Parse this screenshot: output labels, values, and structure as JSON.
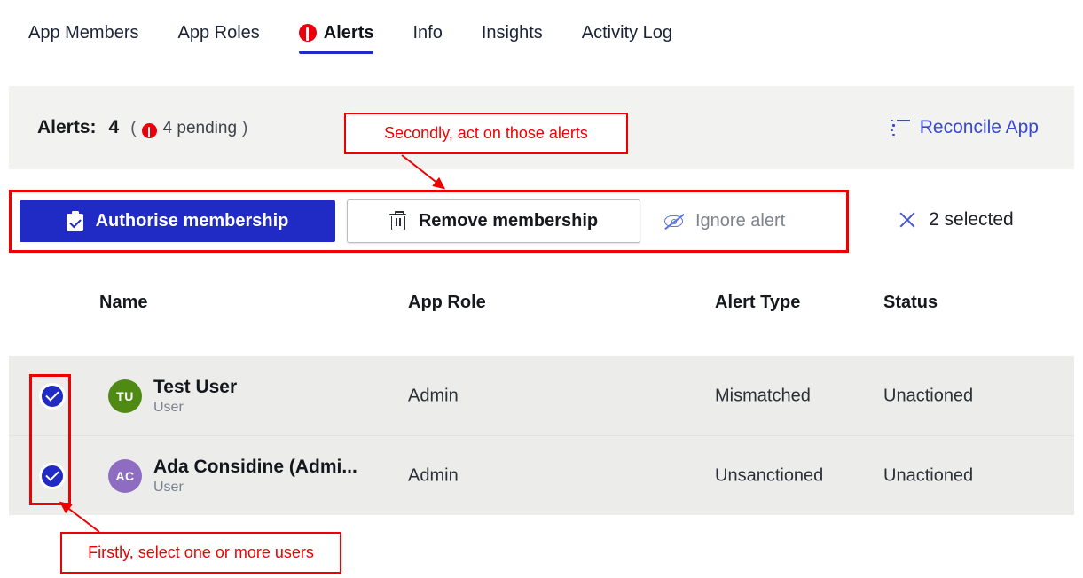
{
  "tabs": [
    {
      "label": "App Members",
      "active": false,
      "icon": null
    },
    {
      "label": "App Roles",
      "active": false,
      "icon": null
    },
    {
      "label": "Alerts",
      "active": true,
      "icon": "alert-exclamation-icon"
    },
    {
      "label": "Info",
      "active": false,
      "icon": null
    },
    {
      "label": "Insights",
      "active": false,
      "icon": null
    },
    {
      "label": "Activity Log",
      "active": false,
      "icon": null
    }
  ],
  "summary": {
    "label": "Alerts:",
    "count": "4",
    "paren_open": "(",
    "paren_close": ")",
    "pending_text": "4 pending",
    "pending_icon": "alert-exclamation-icon",
    "reconcile_label": "Reconcile App",
    "reconcile_icon": "list-checklist-icon"
  },
  "toolbar": {
    "authorise_label": "Authorise membership",
    "authorise_icon": "clipboard-check-icon",
    "remove_label": "Remove membership",
    "remove_icon": "trash-icon",
    "ignore_label": "Ignore alert",
    "ignore_icon": "eye-slash-icon",
    "selected_label": "2 selected",
    "clear_icon": "close-x-icon"
  },
  "table": {
    "columns": [
      "Name",
      "App Role",
      "Alert Type",
      "Status"
    ],
    "rows": [
      {
        "selected": true,
        "initials": "TU",
        "avatar_color": "#4f8a15",
        "name": "Test User",
        "subtitle": "User",
        "app_role": "Admin",
        "alert_type": "Mismatched",
        "status": "Unactioned"
      },
      {
        "selected": true,
        "initials": "AC",
        "avatar_color": "#8d6cc2",
        "name": "Ada Considine (Admi...",
        "subtitle": "User",
        "app_role": "Admin",
        "alert_type": "Unsanctioned",
        "status": "Unactioned"
      }
    ]
  },
  "annotations": {
    "top_note": "Secondly, act on those alerts",
    "bottom_note": "Firstly, select one or more users",
    "color": "#ef0000"
  },
  "colors": {
    "primary_blue": "#1f2bc4",
    "link_blue": "#3a47d5",
    "alert_red": "#e8000d",
    "annotation_red": "#ef0000",
    "row_bg": "#ececea",
    "summary_bg": "#f2f2f1"
  }
}
